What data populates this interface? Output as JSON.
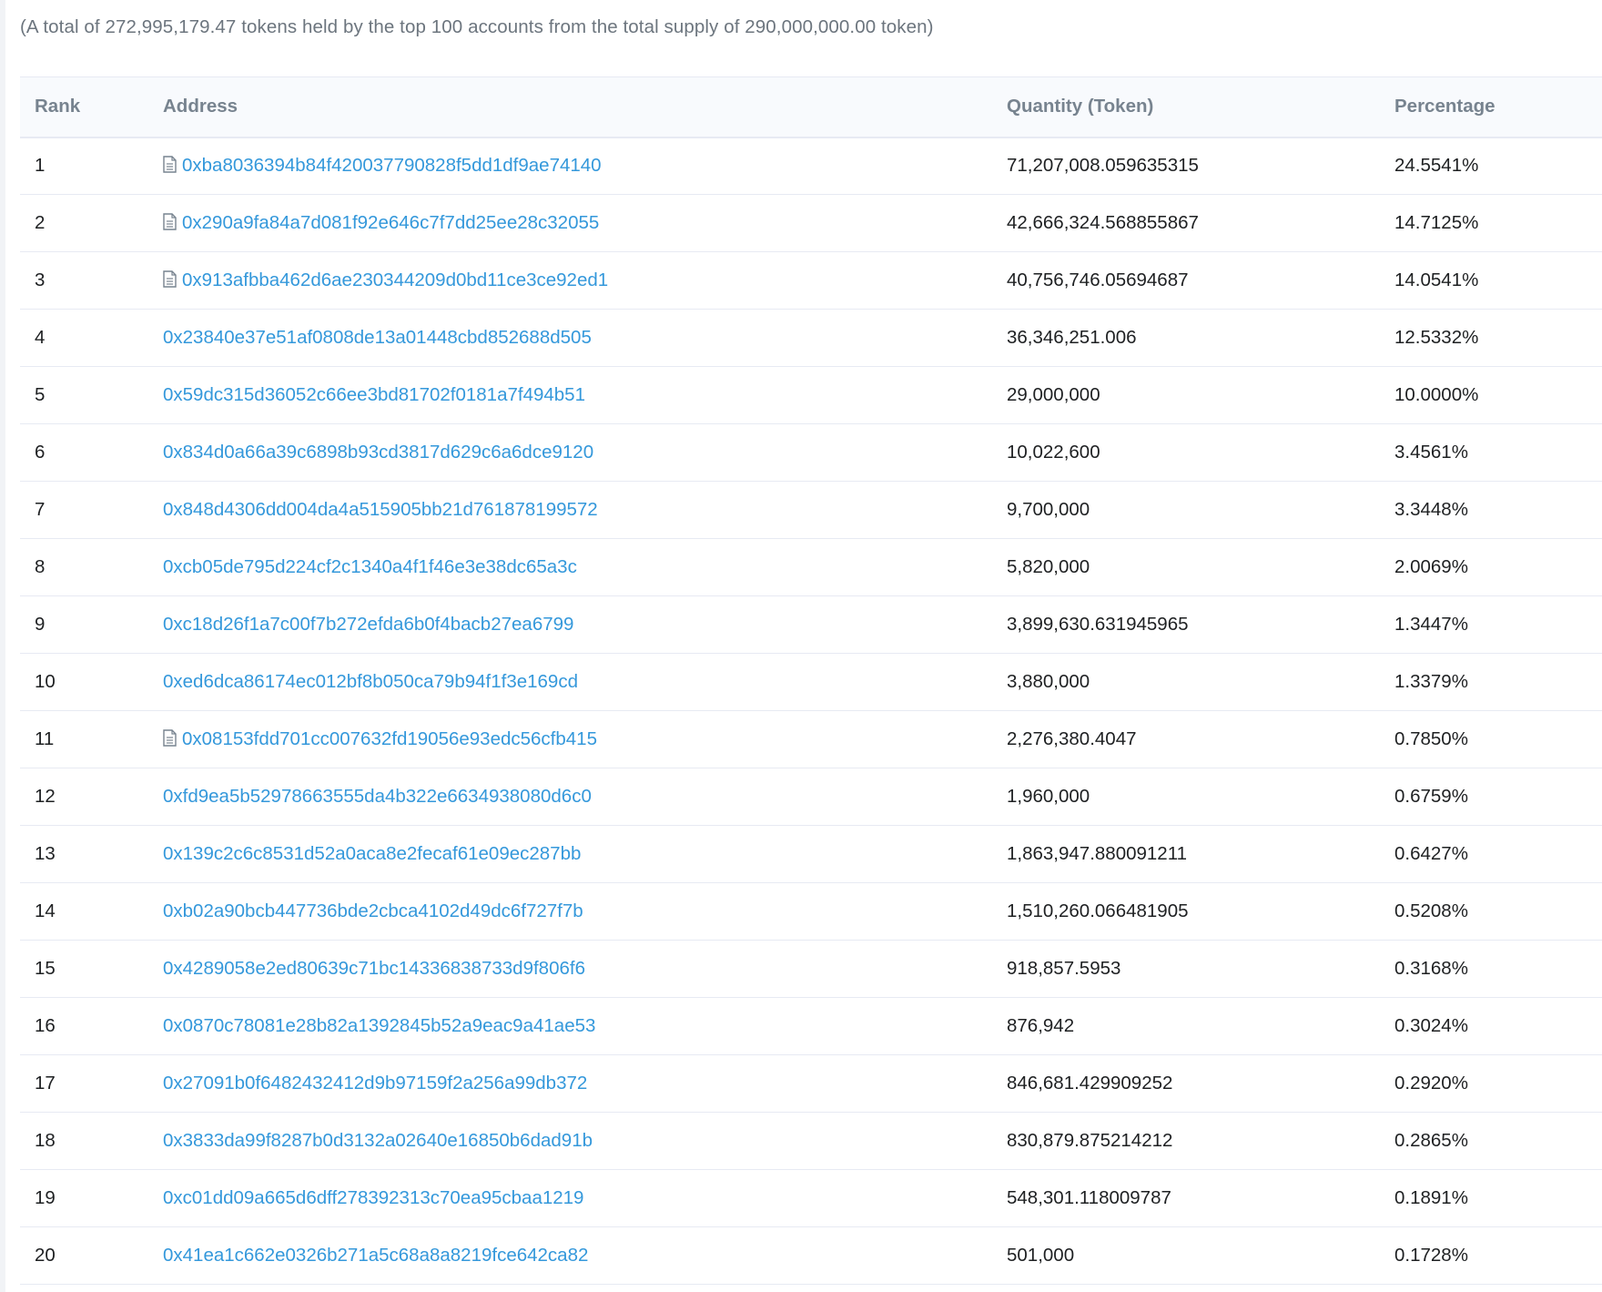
{
  "summary": "(A total of 272,995,179.47 tokens held by the top 100 accounts from the total supply of 290,000,000.00 token)",
  "columns": {
    "rank": "Rank",
    "address": "Address",
    "quantity": "Quantity (Token)",
    "percentage": "Percentage"
  },
  "link_color": "#3498db",
  "rows": [
    {
      "rank": "1",
      "contract": true,
      "address": "0xba8036394b84f420037790828f5dd1df9ae74140",
      "quantity": "71,207,008.059635315",
      "percentage": "24.5541%"
    },
    {
      "rank": "2",
      "contract": true,
      "address": "0x290a9fa84a7d081f92e646c7f7dd25ee28c32055",
      "quantity": "42,666,324.568855867",
      "percentage": "14.7125%"
    },
    {
      "rank": "3",
      "contract": true,
      "address": "0x913afbba462d6ae230344209d0bd11ce3ce92ed1",
      "quantity": "40,756,746.05694687",
      "percentage": "14.0541%"
    },
    {
      "rank": "4",
      "contract": false,
      "address": "0x23840e37e51af0808de13a01448cbd852688d505",
      "quantity": "36,346,251.006",
      "percentage": "12.5332%"
    },
    {
      "rank": "5",
      "contract": false,
      "address": "0x59dc315d36052c66ee3bd81702f0181a7f494b51",
      "quantity": "29,000,000",
      "percentage": "10.0000%"
    },
    {
      "rank": "6",
      "contract": false,
      "address": "0x834d0a66a39c6898b93cd3817d629c6a6dce9120",
      "quantity": "10,022,600",
      "percentage": "3.4561%"
    },
    {
      "rank": "7",
      "contract": false,
      "address": "0x848d4306dd004da4a515905bb21d761878199572",
      "quantity": "9,700,000",
      "percentage": "3.3448%"
    },
    {
      "rank": "8",
      "contract": false,
      "address": "0xcb05de795d224cf2c1340a4f1f46e3e38dc65a3c",
      "quantity": "5,820,000",
      "percentage": "2.0069%"
    },
    {
      "rank": "9",
      "contract": false,
      "address": "0xc18d26f1a7c00f7b272efda6b0f4bacb27ea6799",
      "quantity": "3,899,630.631945965",
      "percentage": "1.3447%"
    },
    {
      "rank": "10",
      "contract": false,
      "address": "0xed6dca86174ec012bf8b050ca79b94f1f3e169cd",
      "quantity": "3,880,000",
      "percentage": "1.3379%"
    },
    {
      "rank": "11",
      "contract": true,
      "address": "0x08153fdd701cc007632fd19056e93edc56cfb415",
      "quantity": "2,276,380.4047",
      "percentage": "0.7850%"
    },
    {
      "rank": "12",
      "contract": false,
      "address": "0xfd9ea5b52978663555da4b322e6634938080d6c0",
      "quantity": "1,960,000",
      "percentage": "0.6759%"
    },
    {
      "rank": "13",
      "contract": false,
      "address": "0x139c2c6c8531d52a0aca8e2fecaf61e09ec287bb",
      "quantity": "1,863,947.880091211",
      "percentage": "0.6427%"
    },
    {
      "rank": "14",
      "contract": false,
      "address": "0xb02a90bcb447736bde2cbca4102d49dc6f727f7b",
      "quantity": "1,510,260.066481905",
      "percentage": "0.5208%"
    },
    {
      "rank": "15",
      "contract": false,
      "address": "0x4289058e2ed80639c71bc14336838733d9f806f6",
      "quantity": "918,857.5953",
      "percentage": "0.3168%"
    },
    {
      "rank": "16",
      "contract": false,
      "address": "0x0870c78081e28b82a1392845b52a9eac9a41ae53",
      "quantity": "876,942",
      "percentage": "0.3024%"
    },
    {
      "rank": "17",
      "contract": false,
      "address": "0x27091b0f6482432412d9b97159f2a256a99db372",
      "quantity": "846,681.429909252",
      "percentage": "0.2920%"
    },
    {
      "rank": "18",
      "contract": false,
      "address": "0x3833da99f8287b0d3132a02640e16850b6dad91b",
      "quantity": "830,879.875214212",
      "percentage": "0.2865%"
    },
    {
      "rank": "19",
      "contract": false,
      "address": "0xc01dd09a665d6dff278392313c70ea95cbaa1219",
      "quantity": "548,301.118009787",
      "percentage": "0.1891%"
    },
    {
      "rank": "20",
      "contract": false,
      "address": "0x41ea1c662e0326b271a5c68a8a8219fce642ca82",
      "quantity": "501,000",
      "percentage": "0.1728%"
    }
  ]
}
